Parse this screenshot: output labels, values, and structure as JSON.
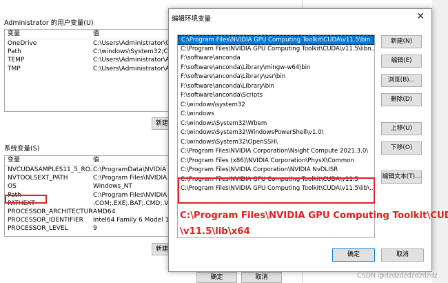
{
  "bg_dialog": {
    "user_vars_label": "Administrator 的用户变量(U)",
    "col_var": "变量",
    "col_val": "值",
    "user_vars": [
      {
        "name": "OneDrive",
        "value": "C:\\Users\\Administrator\\On"
      },
      {
        "name": "Path",
        "value": "C:\\windows\\System32;C:\\w"
      },
      {
        "name": "TEMP",
        "value": "C:\\Users\\Administrator\\Ap"
      },
      {
        "name": "TMP",
        "value": "C:\\Users\\Administrator\\Ap"
      }
    ],
    "new_button_1": "新建",
    "sys_vars_label": "系统变量(S)",
    "sys_vars": [
      {
        "name": "NVCUDASAMPLES11_5_RO...",
        "value": "C:\\ProgramData\\NVIDIA Co"
      },
      {
        "name": "NVTOOLSEXT_PATH",
        "value": "C:\\Program Files\\NVIDIA C"
      },
      {
        "name": "OS",
        "value": "Windows_NT"
      },
      {
        "name": "Path",
        "value": "C:\\Program Files\\NVIDIA G"
      },
      {
        "name": "PATHEXT",
        "value": ".COM;.EXE;.BAT;.CMD;.VBS"
      },
      {
        "name": "PROCESSOR_ARCHITECTURE",
        "value": "AMD64"
      },
      {
        "name": "PROCESSOR_IDENTIFIER",
        "value": "Intel64 Family 6 Model 158"
      },
      {
        "name": "PROCESSOR_LEVEL",
        "value": "9"
      }
    ],
    "new_button_2": "新建",
    "ok": "确定",
    "cancel": "取消"
  },
  "edit_dialog": {
    "title": "编辑环境变量",
    "close": "✕",
    "paths": [
      "C:\\Program Files\\NVIDIA GPU Computing Toolkit\\CUDA\\v11.5\\bin",
      "C:\\Program Files\\NVIDIA GPU Computing Toolkit\\CUDA\\v11.5\\libn...",
      "F:\\software\\anconda",
      "F:\\software\\anconda\\Library\\mingw-w64\\bin",
      "F:\\software\\anconda\\Library\\usr\\bin",
      "F:\\software\\anconda\\Library\\bin",
      "F:\\software\\anconda\\Scripts",
      "C:\\windows\\system32",
      "C:\\windows",
      "C:\\windows\\System32\\Wbem",
      "C:\\windows\\System32\\WindowsPowerShell\\v1.0\\",
      "C:\\windows\\System32\\OpenSSH\\",
      "C:\\Program Files\\NVIDIA Corporation\\Nsight Compute 2021.3.0\\",
      "C:\\Program Files (x86)\\NVIDIA Corporation\\PhysX\\Common",
      "C:\\Program Files\\NVIDIA Corporation\\NVIDIA NvDLISR",
      "C:\\Program Files\\NVIDIA GPU Computing Toolkit\\CUDA\\v11.5",
      "C:\\Program Files\\NVIDIA GPU Computing Toolkit\\CUDA\\v11.5\\lib\\..."
    ],
    "buttons": {
      "new": "新建(N)",
      "edit": "编辑(E)",
      "browse": "浏览(B)...",
      "delete": "删除(D)",
      "move_up": "上移(U)",
      "move_down": "下移(O)",
      "edit_text": "编辑文本(T)..."
    },
    "annotation_line1": "C:\\Program Files\\NVIDIA GPU Computing Toolkit\\CUDA",
    "annotation_line2": "\\v11.5\\lib\\x64",
    "ok": "确定",
    "cancel": "取消"
  },
  "watermark": "CSDN @dzdzdzdzdzdzdz",
  "colors": {
    "selection": "#0078d7",
    "annotation": "#e02020",
    "button": "#e1e1e1"
  }
}
